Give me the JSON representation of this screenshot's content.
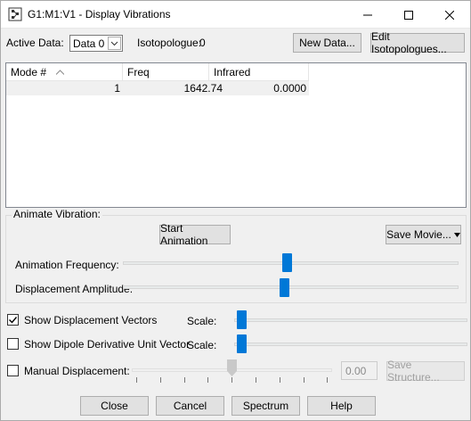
{
  "window": {
    "title": "G1:M1:V1 - Display Vibrations",
    "icon": "gaussview-app-icon"
  },
  "titlebar_buttons": [
    "minimize-icon",
    "maximize-icon",
    "close-icon"
  ],
  "toolbar": {
    "active_data_label": "Active Data:",
    "active_data_value": "Data 0",
    "isotopologue_label": "Isotopologue:",
    "isotopologue_value": "0",
    "new_data_button": "New Data...",
    "edit_isotopologues_button": "Edit Isotopologues..."
  },
  "table": {
    "columns": [
      "Mode #",
      "Freq",
      "Infrared"
    ],
    "sort_column": "Mode #",
    "sort_direction": "ascending",
    "rows": [
      {
        "mode": "1",
        "freq": "1642.74",
        "infrared": "0.0000"
      }
    ]
  },
  "animate": {
    "group_title": "Animate Vibration:",
    "start_button": "Start Animation",
    "save_movie_button": "Save Movie...",
    "frequency_label": "Animation Frequency:",
    "frequency_level": 0.49,
    "amplitude_label": "Displacement Amplitude:",
    "amplitude_level": 0.48
  },
  "options": {
    "show_displacement_vectors_label": "Show Displacement Vectors",
    "show_displacement_vectors_checked": true,
    "displacement_scale_label": "Scale:",
    "displacement_scale_level": 0.01,
    "show_dipole_label": "Show Dipole Derivative Unit Vector",
    "show_dipole_checked": false,
    "dipole_scale_label": "Scale:",
    "dipole_scale_level": 0.01,
    "manual_displacement_label": "Manual Displacement:",
    "manual_displacement_checked": false,
    "manual_displacement_value": "0.00",
    "manual_displacement_level": 0.5,
    "save_structure_button": "Save Structure..."
  },
  "footer": {
    "close_button": "Close",
    "cancel_button": "Cancel",
    "spectrum_button": "Spectrum",
    "help_button": "Help"
  },
  "colors": {
    "accent": "#0078d7",
    "window_bg": "#f0f0f0"
  }
}
